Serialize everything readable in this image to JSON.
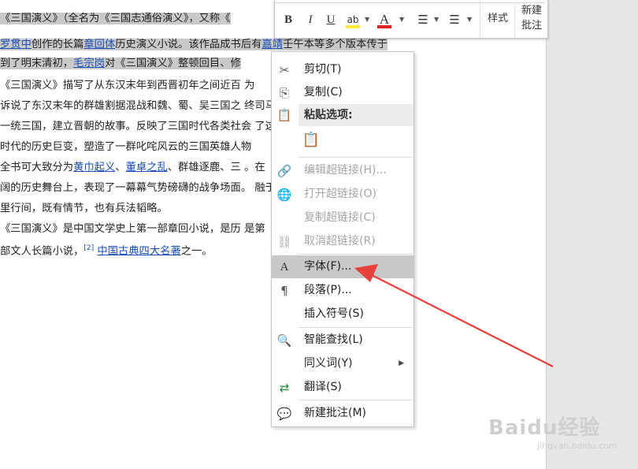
{
  "document": {
    "lines": [
      {
        "segments": [
          {
            "t": "    《三国演义》（全名为《三国志通俗演义》，又称《",
            "hl": true
          }
        ]
      },
      {
        "segments": [
          {
            "t": "罗贯中",
            "link": true,
            "hl": true
          },
          {
            "t": "创作的长篇",
            "hl": true
          },
          {
            "t": "章回体",
            "link": true,
            "hl": true
          },
          {
            "t": "历史演义小说。该作品成书后有",
            "hl": true
          },
          {
            "t": "嘉靖",
            "link": true,
            "hl": true
          },
          {
            "t": "壬午本等多个版本传于",
            "hl": true
          }
        ]
      },
      {
        "segments": [
          {
            "t": "    到了明末清初，",
            "hl": true
          },
          {
            "t": "毛宗岗",
            "link": true,
            "hl": true
          },
          {
            "t": "对《三国演义》整顿回目、修",
            "hl": true
          }
        ]
      },
      {
        "segments": [
          {
            "t": "    《三国演义》描写了从东汉末年到西晋初年之间近百"
          },
          {
            "t": "                         ",
            "pad": true
          },
          {
            "t": "为"
          }
        ]
      },
      {
        "segments": [
          {
            "t": "    诉说了东汉末年的群雄割据混战和魏、蜀、吴三国之"
          },
          {
            "t": "                         ",
            "pad": true
          },
          {
            "t": "终司马"
          }
        ]
      },
      {
        "segments": [
          {
            "t": "一统三国，建立晋朝的故事。反映了三国时代各类社会"
          },
          {
            "t": "                         ",
            "pad": true
          },
          {
            "t": "了这"
          }
        ]
      },
      {
        "segments": [
          {
            "t": "时代的历史巨变，塑造了一群叱咤风云的三国英雄人物"
          }
        ]
      },
      {
        "segments": [
          {
            "t": "    全书可大致分为"
          },
          {
            "t": "黄巾起义",
            "link": true
          },
          {
            "t": "、"
          },
          {
            "t": "董卓之乱",
            "link": true
          },
          {
            "t": "、群雄逐鹿、三"
          },
          {
            "t": "                         ",
            "pad": true
          },
          {
            "t": "。在"
          }
        ]
      },
      {
        "segments": [
          {
            "t": "阔的历史舞台上，表现了一幕幕气势磅礴的战争场面。"
          },
          {
            "t": "                         ",
            "pad": true
          },
          {
            "t": "融于"
          }
        ]
      },
      {
        "segments": [
          {
            "t": "里行间，既有情节，也有兵法韬略。"
          }
        ]
      },
      {
        "segments": [
          {
            "t": "    《三国演义》是中国文学史上第一部章回小说，是历"
          },
          {
            "t": "                         ",
            "pad": true
          },
          {
            "t": "是第"
          }
        ]
      },
      {
        "segments": [
          {
            "t": "部文人长篇小说，"
          },
          {
            "t": "[2]",
            "sup": true
          },
          {
            "t": " "
          },
          {
            "t": "中国古典四大名著",
            "link": true
          },
          {
            "t": "之一。"
          }
        ]
      }
    ]
  },
  "mini_toolbar": {
    "bold": "B",
    "italic": "I",
    "underline": "U",
    "highlight": "ab",
    "font_color": "A",
    "bullets": "☰",
    "numbering": "☰",
    "styles": "样式",
    "new_comment_line1": "新建",
    "new_comment_line2": "批注",
    "highlight_color": "#f5e93b",
    "font_color_value": "#e02020"
  },
  "context_menu": {
    "cut": "剪切(T)",
    "copy": "复制(C)",
    "paste_options": "粘贴选项:",
    "edit_hyperlink": "编辑超链接(H)...",
    "open_hyperlink": "打开超链接(O)",
    "copy_hyperlink": "复制超链接(C)",
    "remove_hyperlink": "取消超链接(R)",
    "font": "字体(F)...",
    "paragraph": "段落(P)...",
    "insert_symbol": "插入符号(S)",
    "smart_lookup": "智能查找(L)",
    "synonyms": "同义词(Y)",
    "translate": "翻译(S)",
    "new_comment": "新建批注(M)"
  },
  "annotation": {
    "arrow_color": "#e8403a"
  },
  "watermark": {
    "brand": "Baidu经验",
    "url": "jingyan.baidu.com"
  }
}
